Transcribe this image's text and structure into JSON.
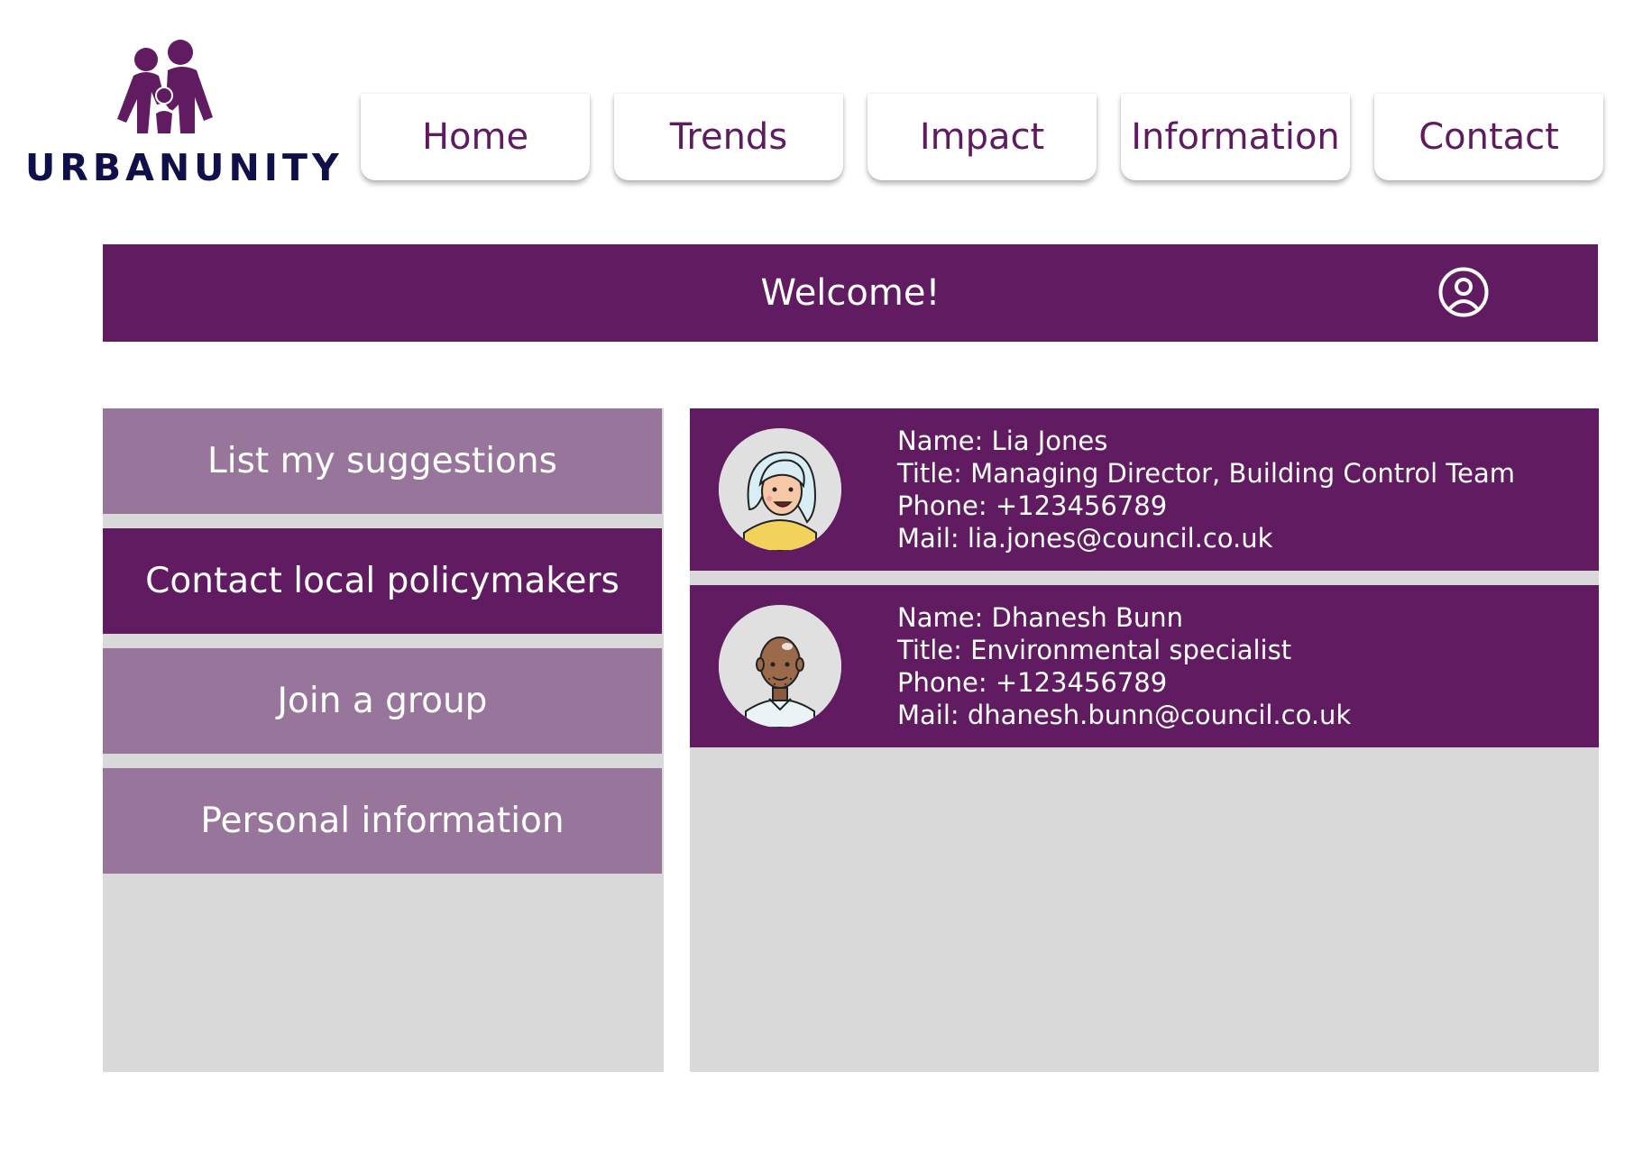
{
  "brand": {
    "name": "URBANUNITY",
    "logo_icon": "family-icon",
    "primary_color": "#601b61",
    "muted_color": "#98769c",
    "panel_color": "#d9d9d9",
    "logo_text_color": "#0f0f4a"
  },
  "nav": {
    "tabs": [
      {
        "label": "Home"
      },
      {
        "label": "Trends"
      },
      {
        "label": "Impact"
      },
      {
        "label": "Information"
      },
      {
        "label": "Contact"
      }
    ]
  },
  "welcome": {
    "title": "Welcome!",
    "account_icon": "user-circle-icon"
  },
  "menu": {
    "items": [
      {
        "label": "List my suggestions",
        "active": false
      },
      {
        "label": "Contact local policymakers",
        "active": true
      },
      {
        "label": "Join a group",
        "active": false
      },
      {
        "label": "Personal information",
        "active": false
      }
    ]
  },
  "contacts": [
    {
      "avatar_icon": "woman-avatar-icon",
      "name": "Name: Lia Jones",
      "title": "Title: Managing Director, Building Control Team",
      "phone": "Phone: +123456789",
      "mail": "Mail: lia.jones@council.co.uk"
    },
    {
      "avatar_icon": "man-avatar-icon",
      "name": "Name: Dhanesh Bunn",
      "title": "Title: Environmental specialist",
      "phone": "Phone: +123456789",
      "mail": "Mail: dhanesh.bunn@council.co.uk"
    }
  ]
}
